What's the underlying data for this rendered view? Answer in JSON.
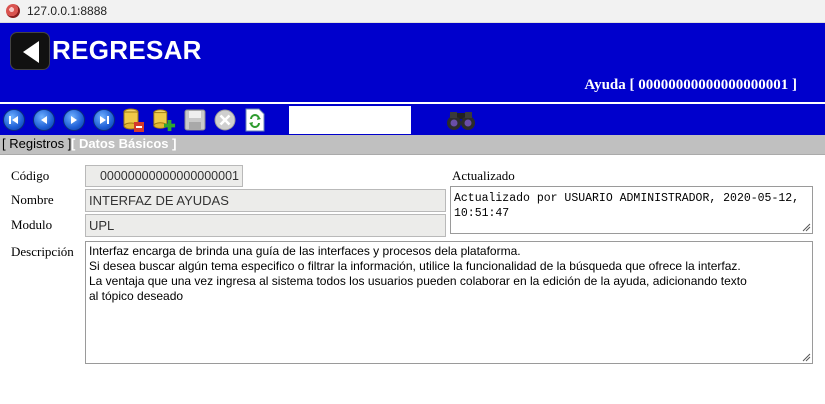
{
  "browser": {
    "url": "127.0.0.1:8888"
  },
  "header": {
    "back_label": "REGRESAR",
    "help_title": "Ayuda [ 00000000000000000001 ]"
  },
  "toolbar": {
    "buttons": [
      "first-record",
      "previous-record",
      "next-record",
      "last-record",
      "delete-record",
      "add-record",
      "save-record",
      "cancel",
      "refresh"
    ]
  },
  "tabs": [
    {
      "label": "[ Registros ]"
    },
    {
      "label": "[ Datos Básicos ]"
    }
  ],
  "form": {
    "codigo_label": "Código",
    "codigo_value": "00000000000000000001",
    "nombre_label": "Nombre",
    "nombre_value": "INTERFAZ DE AYUDAS",
    "modulo_label": "Modulo",
    "modulo_value": "UPL",
    "actualizado_label": "Actualizado",
    "actualizado_line1": "Actualizado por USUARIO ADMINISTRADOR, 2020-05-12,",
    "actualizado_line2": "10:51:47",
    "descripcion_label": "Descripción",
    "descripcion_lines": [
      "Interfaz encarga de brinda una guía de las interfaces y procesos dela plataforma.",
      "Si desea buscar algún tema especifico o filtrar la información, utilice la funcionalidad de la búsqueda que ofrece la interfaz.",
      "La ventaja que una vez ingresa al sistema todos los usuarios pueden colaborar en la edición de la ayuda, adicionando texto",
      "al tópico deseado"
    ]
  }
}
